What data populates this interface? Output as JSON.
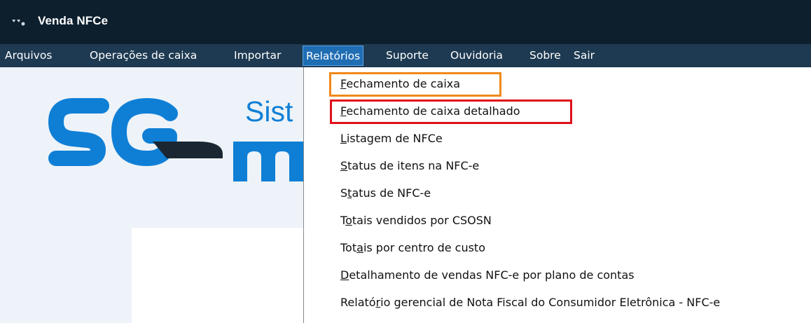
{
  "window": {
    "title": "Venda NFCe"
  },
  "menubar": {
    "items": [
      {
        "label": "Arquivos"
      },
      {
        "label": "Operações de caixa"
      },
      {
        "label": "Importar"
      },
      {
        "label": "Relatórios",
        "active": true
      },
      {
        "label": "Suporte"
      },
      {
        "label": "Ouvidoria"
      },
      {
        "label": "Sobre"
      },
      {
        "label": "Sair"
      }
    ]
  },
  "logo": {
    "letters": "SG",
    "text": "Sist",
    "text2": "m"
  },
  "dropdown": {
    "items": [
      {
        "pre": "",
        "u": "F",
        "post": "echamento de caixa",
        "highlight": "orange"
      },
      {
        "pre": "",
        "u": "F",
        "post": "echamento de caixa detalhado",
        "highlight": "red"
      },
      {
        "pre": "",
        "u": "L",
        "post": "istagem de NFCe"
      },
      {
        "pre": "",
        "u": "S",
        "post": "tatus de itens na NFC-e"
      },
      {
        "pre": "S",
        "u": "t",
        "post": "atus de NFC-e"
      },
      {
        "pre": "T",
        "u": "o",
        "post": "tais vendidos por CSOSN"
      },
      {
        "pre": "Tot",
        "u": "a",
        "post": "is por centro de custo"
      },
      {
        "pre": "",
        "u": "D",
        "post": "etalhamento de vendas NFC-e por plano de contas"
      },
      {
        "pre": "Relató",
        "u": "r",
        "post": "io gerencial de Nota Fiscal do Consumidor Eletrônica - NFC-e"
      }
    ]
  },
  "colors": {
    "titlebar": "#0d1f2d",
    "menubar": "#1e3a52",
    "accent": "#1f6db3",
    "logo": "#0f7fd6",
    "highlight_orange": "#f0891a",
    "highlight_red": "#e0101a"
  }
}
